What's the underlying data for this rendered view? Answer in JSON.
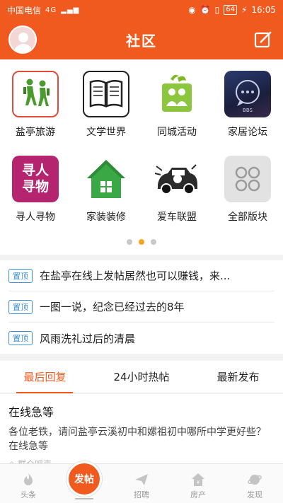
{
  "statusbar": {
    "carrier": "中国电信",
    "network": "4G",
    "battery": "64",
    "time": "16:05"
  },
  "header": {
    "title": "社区"
  },
  "categories": [
    {
      "label": "盐亭旅游",
      "icon": "hiking-icon"
    },
    {
      "label": "文学世界",
      "icon": "book-icon"
    },
    {
      "label": "同城活动",
      "icon": "people-group-icon"
    },
    {
      "label": "家居论坛",
      "icon": "bbs-chat-icon"
    },
    {
      "label": "寻人寻物",
      "icon": "lost-found-icon",
      "icon_text_1": "寻人",
      "icon_text_2": "寻物"
    },
    {
      "label": "家装装修",
      "icon": "house-icon"
    },
    {
      "label": "爱车联盟",
      "icon": "car-icon"
    },
    {
      "label": "全部版块",
      "icon": "all-sections-icon"
    }
  ],
  "pager": {
    "total": 3,
    "active": 2
  },
  "pinned": {
    "tag": "置顶",
    "items": [
      "在盐亭在线上发帖居然也可以赚钱，来...",
      "一图一说，纪念已经过去的8年",
      "风雨洗礼过后的清晨"
    ]
  },
  "tabs": [
    "最后回复",
    "24小时热帖",
    "最新发布"
  ],
  "post": {
    "title": "在线急等",
    "body": "各位老铁，请问盐亭云溪初中和嫘祖初中哪所中学更好些？在线急等",
    "meta": "群众呼声"
  },
  "bottomnav": {
    "items": [
      "头条",
      "",
      "招聘",
      "房产",
      "发现"
    ],
    "fab_label": "发帖"
  },
  "colors": {
    "accent": "#f05a1f",
    "pin": "#3d8fd6",
    "dot_active": "#f5a623"
  }
}
